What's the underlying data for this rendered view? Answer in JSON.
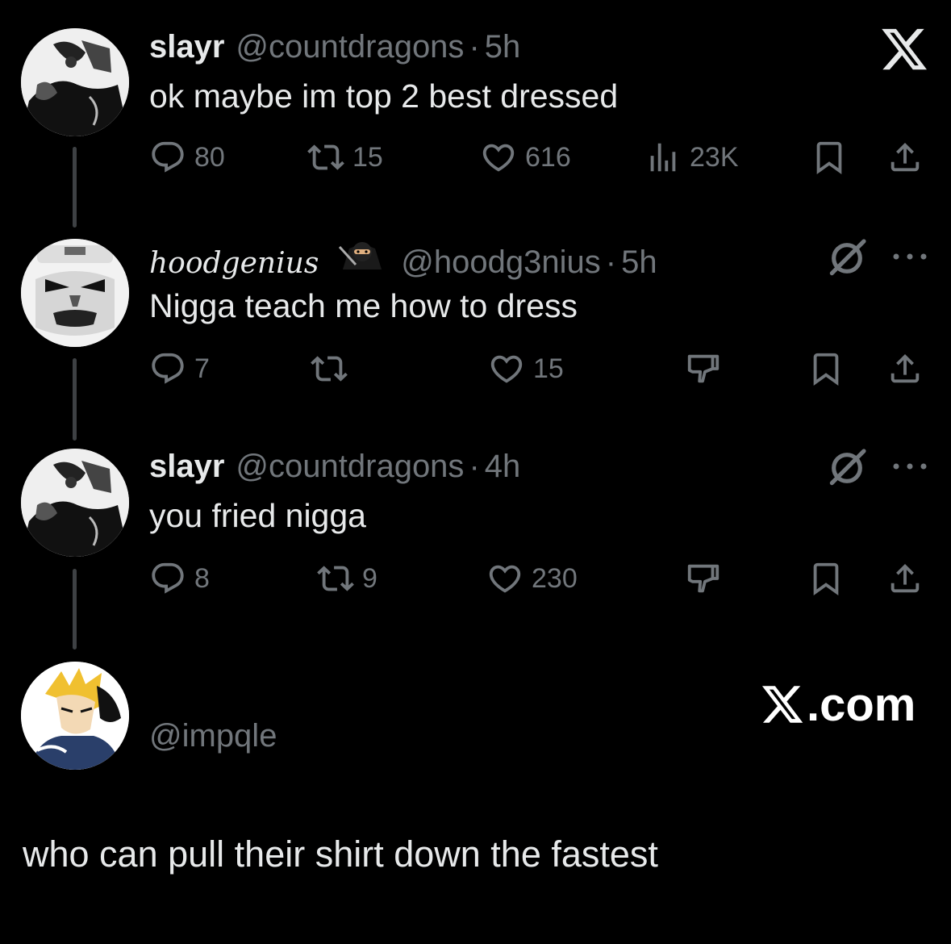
{
  "tweets": [
    {
      "name": "slayr",
      "handle": "@countdragons",
      "sep": "·",
      "time": "5h",
      "text": "ok maybe im top 2 best dressed",
      "replies": "80",
      "retweets": "15",
      "likes": "616",
      "views": "23K"
    },
    {
      "name": "hoodgenius",
      "handle": "@hoodg3nius",
      "sep": "·",
      "time": "5h",
      "text": "Nigga teach me how to dress",
      "replies": "7",
      "retweets": "",
      "likes": "15"
    },
    {
      "name": "slayr",
      "handle": "@countdragons",
      "sep": "·",
      "time": "4h",
      "text": "you fried nigga",
      "replies": "8",
      "retweets": "9",
      "likes": "230"
    }
  ],
  "poster": {
    "handle": "@impqle",
    "brand": ".com",
    "caption": "who can pull their shirt down the fastest"
  },
  "icons": {
    "reply": "reply-icon",
    "retweet": "retweet-icon",
    "like": "heart-icon",
    "views": "views-icon",
    "bookmark": "bookmark-icon",
    "share": "share-icon",
    "downvote": "downvote-icon",
    "grok": "grok-icon",
    "more": "more-icon",
    "x_logo": "x-logo-icon"
  },
  "colors": {
    "background": "#000000",
    "text": "#e7e9ea",
    "muted": "#71767b",
    "thread_line": "#3e4144"
  }
}
